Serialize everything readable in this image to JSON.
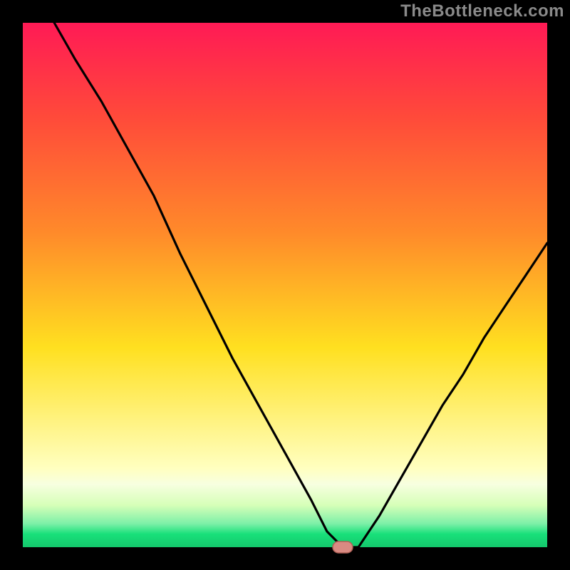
{
  "watermark": "TheBottleneck.com",
  "chart_data": {
    "type": "line",
    "title": "",
    "xlabel": "",
    "ylabel": "",
    "xlim": [
      0,
      100
    ],
    "ylim": [
      0,
      100
    ],
    "grid": false,
    "legend": false,
    "colors": {
      "gradient_top": "#ff1a55",
      "gradient_mid1": "#ff8a2a",
      "gradient_mid2": "#ffe020",
      "gradient_pale": "#ffffc0",
      "gradient_green": "#18e07a",
      "line": "#000000",
      "marker_fill": "#d98a82",
      "marker_stroke": "#b06056",
      "frame": "#000000"
    },
    "marker": {
      "x": 61,
      "y": 0
    },
    "series": [
      {
        "name": "bottleneck-curve",
        "x": [
          6,
          10,
          15,
          20,
          25,
          30,
          35,
          40,
          45,
          50,
          55,
          58,
          61,
          64,
          68,
          72,
          76,
          80,
          84,
          88,
          92,
          96,
          100
        ],
        "values": [
          100,
          93,
          85,
          76,
          67,
          56,
          46,
          36,
          27,
          18,
          9,
          3,
          0,
          0,
          6,
          13,
          20,
          27,
          33,
          40,
          46,
          52,
          58
        ]
      }
    ]
  }
}
